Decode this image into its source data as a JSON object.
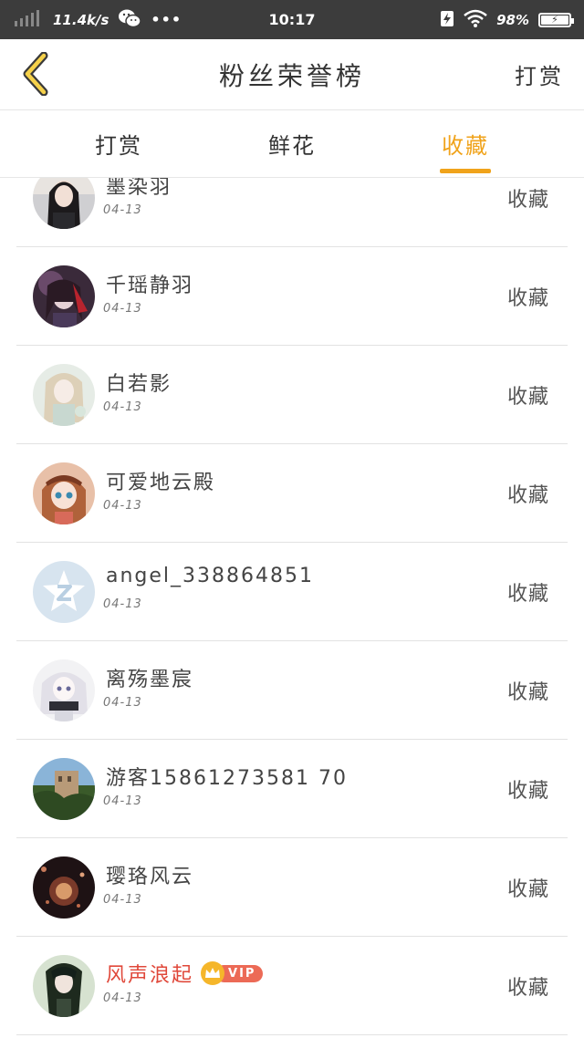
{
  "status_bar": {
    "net_speed": "11.4k/s",
    "dots": "•••",
    "time": "10:17",
    "battery_pct": "98%"
  },
  "header": {
    "title": "粉丝荣誉榜",
    "action": "打赏"
  },
  "tabs": [
    {
      "label": "打赏"
    },
    {
      "label": "鲜花"
    },
    {
      "label": "收藏"
    }
  ],
  "colors": {
    "accent": "#f0a31b",
    "vip_name": "#e0483a",
    "status_bar": "#3c3c3c"
  },
  "list": [
    {
      "name": "墨染羽",
      "date": "04-13",
      "action": "收藏"
    },
    {
      "name": "千瑶静羽",
      "date": "04-13",
      "action": "收藏"
    },
    {
      "name": "白若影",
      "date": "04-13",
      "action": "收藏"
    },
    {
      "name": "可爱地云殿",
      "date": "04-13",
      "action": "收藏"
    },
    {
      "name": "angel_338864851",
      "date": "04-13",
      "action": "收藏"
    },
    {
      "name": "离殇墨宸",
      "date": "04-13",
      "action": "收藏"
    },
    {
      "name": "游客15861273581 70",
      "date": "04-13",
      "action": "收藏"
    },
    {
      "name": "璎珞风云",
      "date": "04-13",
      "action": "收藏"
    },
    {
      "name": "风声浪起",
      "date": "04-13",
      "action": "收藏",
      "badge": "VIP"
    }
  ]
}
